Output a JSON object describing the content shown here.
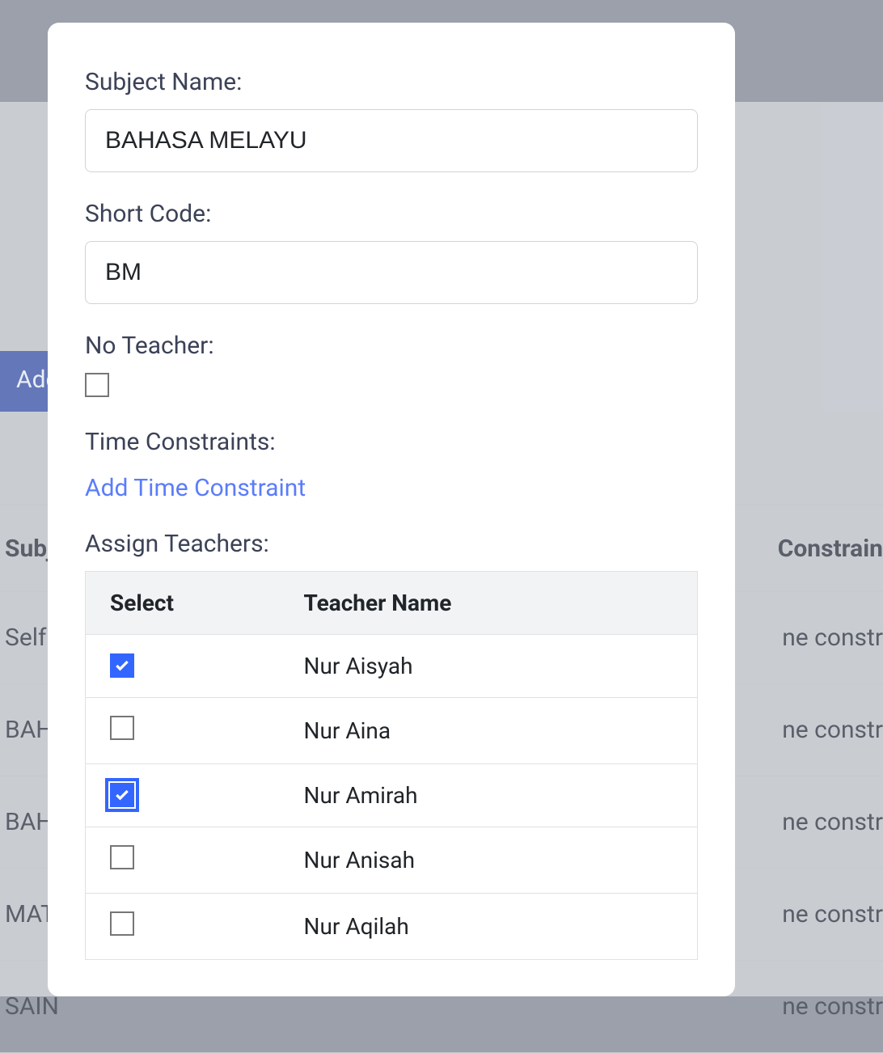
{
  "background": {
    "add_button": "Add",
    "table_header_subject": "Subj",
    "table_header_constraint": "Constrain",
    "rows": [
      {
        "subject": "Self",
        "constraint": "ne constr"
      },
      {
        "subject": "BAH",
        "constraint": "ne constr"
      },
      {
        "subject": "BAH",
        "constraint": "ne constr"
      },
      {
        "subject": "MAT",
        "constraint": "ne constr"
      },
      {
        "subject": "SAIN",
        "constraint": "ne constr"
      }
    ]
  },
  "modal": {
    "subject_name_label": "Subject Name:",
    "subject_name_value": "BAHASA MELAYU",
    "short_code_label": "Short Code:",
    "short_code_value": "BM",
    "no_teacher_label": "No Teacher:",
    "no_teacher_checked": false,
    "time_constraints_label": "Time Constraints:",
    "add_time_constraint_link": "Add Time Constraint",
    "assign_teachers_label": "Assign Teachers:",
    "teachers_table": {
      "col_select": "Select",
      "col_name": "Teacher Name",
      "rows": [
        {
          "name": "Nur Aisyah",
          "checked": true,
          "focused": false
        },
        {
          "name": "Nur Aina",
          "checked": false,
          "focused": false
        },
        {
          "name": "Nur Amirah",
          "checked": true,
          "focused": true
        },
        {
          "name": "Nur Anisah",
          "checked": false,
          "focused": false
        },
        {
          "name": "Nur Aqilah",
          "checked": false,
          "focused": false
        }
      ]
    }
  }
}
